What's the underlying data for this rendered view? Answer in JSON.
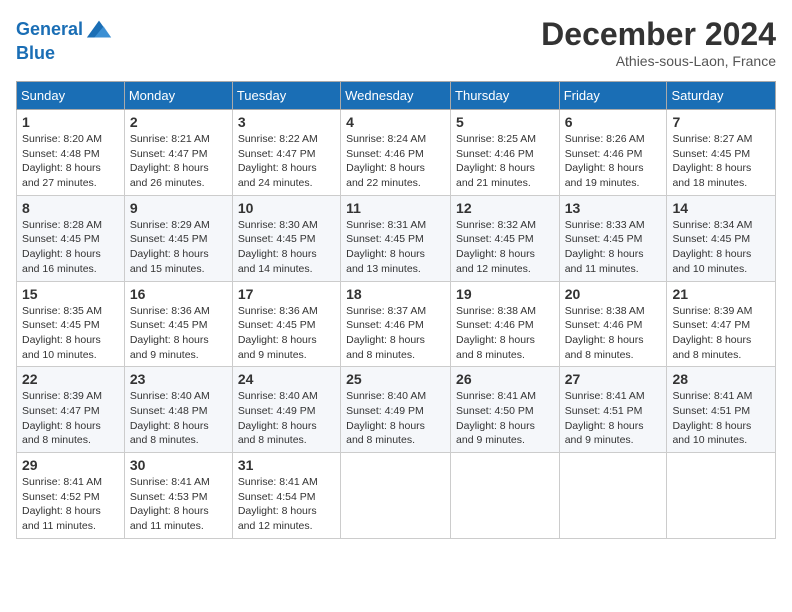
{
  "header": {
    "logo_line1": "General",
    "logo_line2": "Blue",
    "month_title": "December 2024",
    "location": "Athies-sous-Laon, France"
  },
  "days_of_week": [
    "Sunday",
    "Monday",
    "Tuesday",
    "Wednesday",
    "Thursday",
    "Friday",
    "Saturday"
  ],
  "weeks": [
    [
      {
        "day": "1",
        "sunrise": "8:20 AM",
        "sunset": "4:48 PM",
        "daylight": "8 hours and 27 minutes."
      },
      {
        "day": "2",
        "sunrise": "8:21 AM",
        "sunset": "4:47 PM",
        "daylight": "8 hours and 26 minutes."
      },
      {
        "day": "3",
        "sunrise": "8:22 AM",
        "sunset": "4:47 PM",
        "daylight": "8 hours and 24 minutes."
      },
      {
        "day": "4",
        "sunrise": "8:24 AM",
        "sunset": "4:46 PM",
        "daylight": "8 hours and 22 minutes."
      },
      {
        "day": "5",
        "sunrise": "8:25 AM",
        "sunset": "4:46 PM",
        "daylight": "8 hours and 21 minutes."
      },
      {
        "day": "6",
        "sunrise": "8:26 AM",
        "sunset": "4:46 PM",
        "daylight": "8 hours and 19 minutes."
      },
      {
        "day": "7",
        "sunrise": "8:27 AM",
        "sunset": "4:45 PM",
        "daylight": "8 hours and 18 minutes."
      }
    ],
    [
      {
        "day": "8",
        "sunrise": "8:28 AM",
        "sunset": "4:45 PM",
        "daylight": "8 hours and 16 minutes."
      },
      {
        "day": "9",
        "sunrise": "8:29 AM",
        "sunset": "4:45 PM",
        "daylight": "8 hours and 15 minutes."
      },
      {
        "day": "10",
        "sunrise": "8:30 AM",
        "sunset": "4:45 PM",
        "daylight": "8 hours and 14 minutes."
      },
      {
        "day": "11",
        "sunrise": "8:31 AM",
        "sunset": "4:45 PM",
        "daylight": "8 hours and 13 minutes."
      },
      {
        "day": "12",
        "sunrise": "8:32 AM",
        "sunset": "4:45 PM",
        "daylight": "8 hours and 12 minutes."
      },
      {
        "day": "13",
        "sunrise": "8:33 AM",
        "sunset": "4:45 PM",
        "daylight": "8 hours and 11 minutes."
      },
      {
        "day": "14",
        "sunrise": "8:34 AM",
        "sunset": "4:45 PM",
        "daylight": "8 hours and 10 minutes."
      }
    ],
    [
      {
        "day": "15",
        "sunrise": "8:35 AM",
        "sunset": "4:45 PM",
        "daylight": "8 hours and 10 minutes."
      },
      {
        "day": "16",
        "sunrise": "8:36 AM",
        "sunset": "4:45 PM",
        "daylight": "8 hours and 9 minutes."
      },
      {
        "day": "17",
        "sunrise": "8:36 AM",
        "sunset": "4:45 PM",
        "daylight": "8 hours and 9 minutes."
      },
      {
        "day": "18",
        "sunrise": "8:37 AM",
        "sunset": "4:46 PM",
        "daylight": "8 hours and 8 minutes."
      },
      {
        "day": "19",
        "sunrise": "8:38 AM",
        "sunset": "4:46 PM",
        "daylight": "8 hours and 8 minutes."
      },
      {
        "day": "20",
        "sunrise": "8:38 AM",
        "sunset": "4:46 PM",
        "daylight": "8 hours and 8 minutes."
      },
      {
        "day": "21",
        "sunrise": "8:39 AM",
        "sunset": "4:47 PM",
        "daylight": "8 hours and 8 minutes."
      }
    ],
    [
      {
        "day": "22",
        "sunrise": "8:39 AM",
        "sunset": "4:47 PM",
        "daylight": "8 hours and 8 minutes."
      },
      {
        "day": "23",
        "sunrise": "8:40 AM",
        "sunset": "4:48 PM",
        "daylight": "8 hours and 8 minutes."
      },
      {
        "day": "24",
        "sunrise": "8:40 AM",
        "sunset": "4:49 PM",
        "daylight": "8 hours and 8 minutes."
      },
      {
        "day": "25",
        "sunrise": "8:40 AM",
        "sunset": "4:49 PM",
        "daylight": "8 hours and 8 minutes."
      },
      {
        "day": "26",
        "sunrise": "8:41 AM",
        "sunset": "4:50 PM",
        "daylight": "8 hours and 9 minutes."
      },
      {
        "day": "27",
        "sunrise": "8:41 AM",
        "sunset": "4:51 PM",
        "daylight": "8 hours and 9 minutes."
      },
      {
        "day": "28",
        "sunrise": "8:41 AM",
        "sunset": "4:51 PM",
        "daylight": "8 hours and 10 minutes."
      }
    ],
    [
      {
        "day": "29",
        "sunrise": "8:41 AM",
        "sunset": "4:52 PM",
        "daylight": "8 hours and 11 minutes."
      },
      {
        "day": "30",
        "sunrise": "8:41 AM",
        "sunset": "4:53 PM",
        "daylight": "8 hours and 11 minutes."
      },
      {
        "day": "31",
        "sunrise": "8:41 AM",
        "sunset": "4:54 PM",
        "daylight": "8 hours and 12 minutes."
      },
      null,
      null,
      null,
      null
    ]
  ],
  "labels": {
    "sunrise_prefix": "Sunrise: ",
    "sunset_prefix": "Sunset: ",
    "daylight_prefix": "Daylight: "
  }
}
